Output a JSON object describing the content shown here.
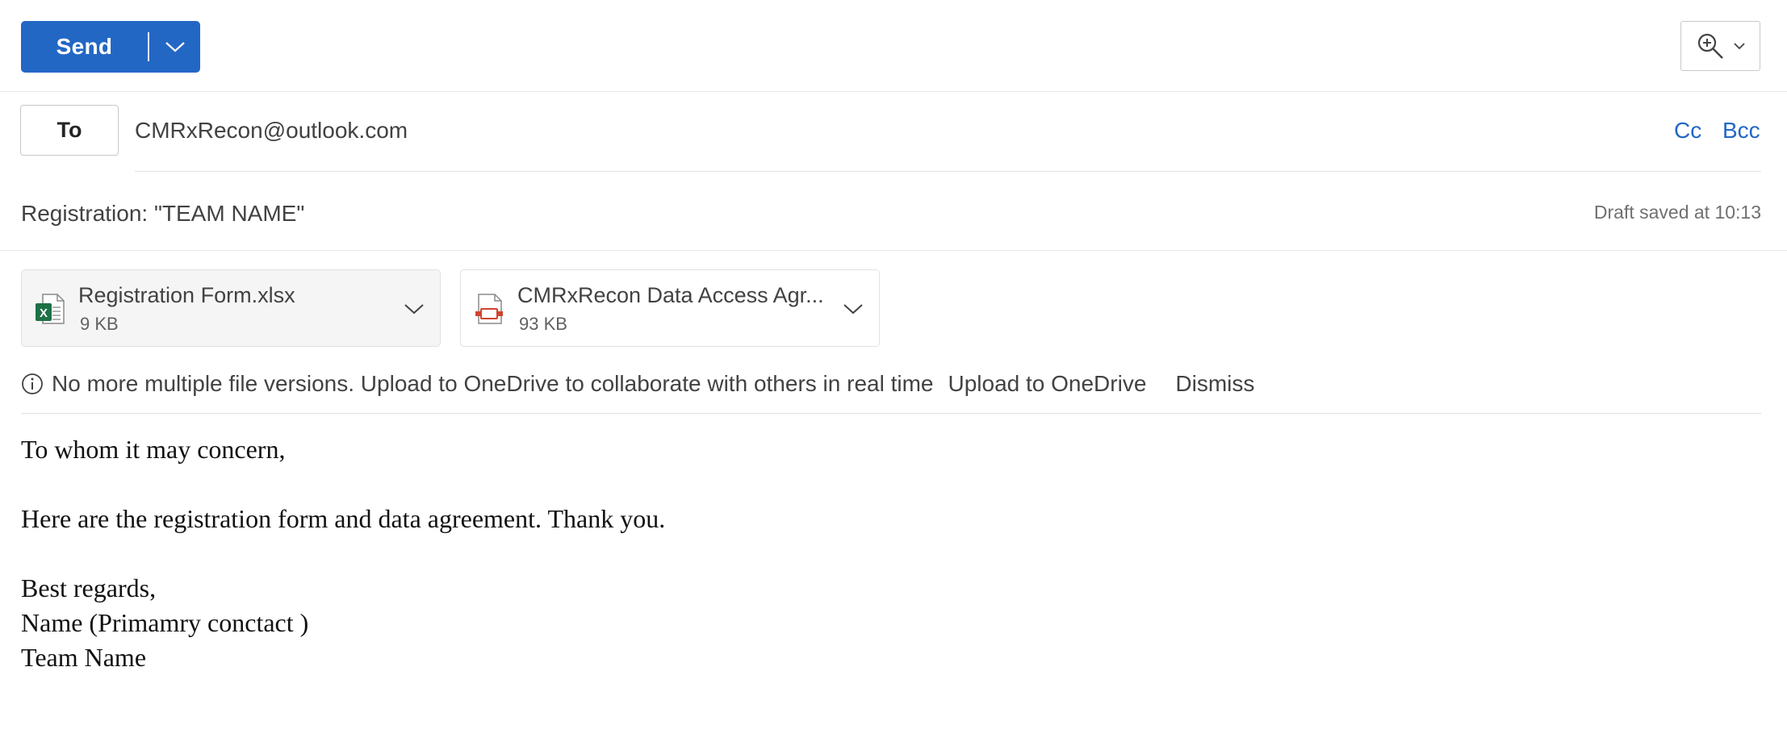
{
  "toolbar": {
    "send_label": "Send",
    "send_options_icon": "chevron-down-icon",
    "zoom_icon": "zoom-in-icon",
    "zoom_caret_icon": "chevron-down-icon"
  },
  "recipients": {
    "to_label": "To",
    "to_value": "CMRxRecon@outlook.com",
    "cc_label": "Cc",
    "bcc_label": "Bcc"
  },
  "subject": {
    "value": "Registration: \"TEAM NAME\"",
    "draft_status": "Draft saved at 10:13"
  },
  "attachments": [
    {
      "name": "Registration Form.xlsx",
      "size": "9 KB",
      "icon": "excel-file-icon",
      "selected": true
    },
    {
      "name": "CMRxRecon Data Access Agr...",
      "size": "93 KB",
      "icon": "pdf-file-icon",
      "selected": false
    }
  ],
  "banner": {
    "icon": "info-icon",
    "message": "No more multiple file versions. Upload to OneDrive to collaborate with others in real time",
    "upload_label": "Upload to OneDrive",
    "dismiss_label": "Dismiss"
  },
  "body": {
    "lines": [
      "To whom it may concern,",
      "",
      "Here are the registration form and data agreement. Thank you.",
      "",
      "Best regards,",
      "Name (Primamry conctact )",
      "Team Name"
    ]
  },
  "colors": {
    "accent": "#2367c5",
    "border": "#c8c8c8",
    "excel_green": "#1e7145",
    "pdf_red": "#d0442e"
  }
}
